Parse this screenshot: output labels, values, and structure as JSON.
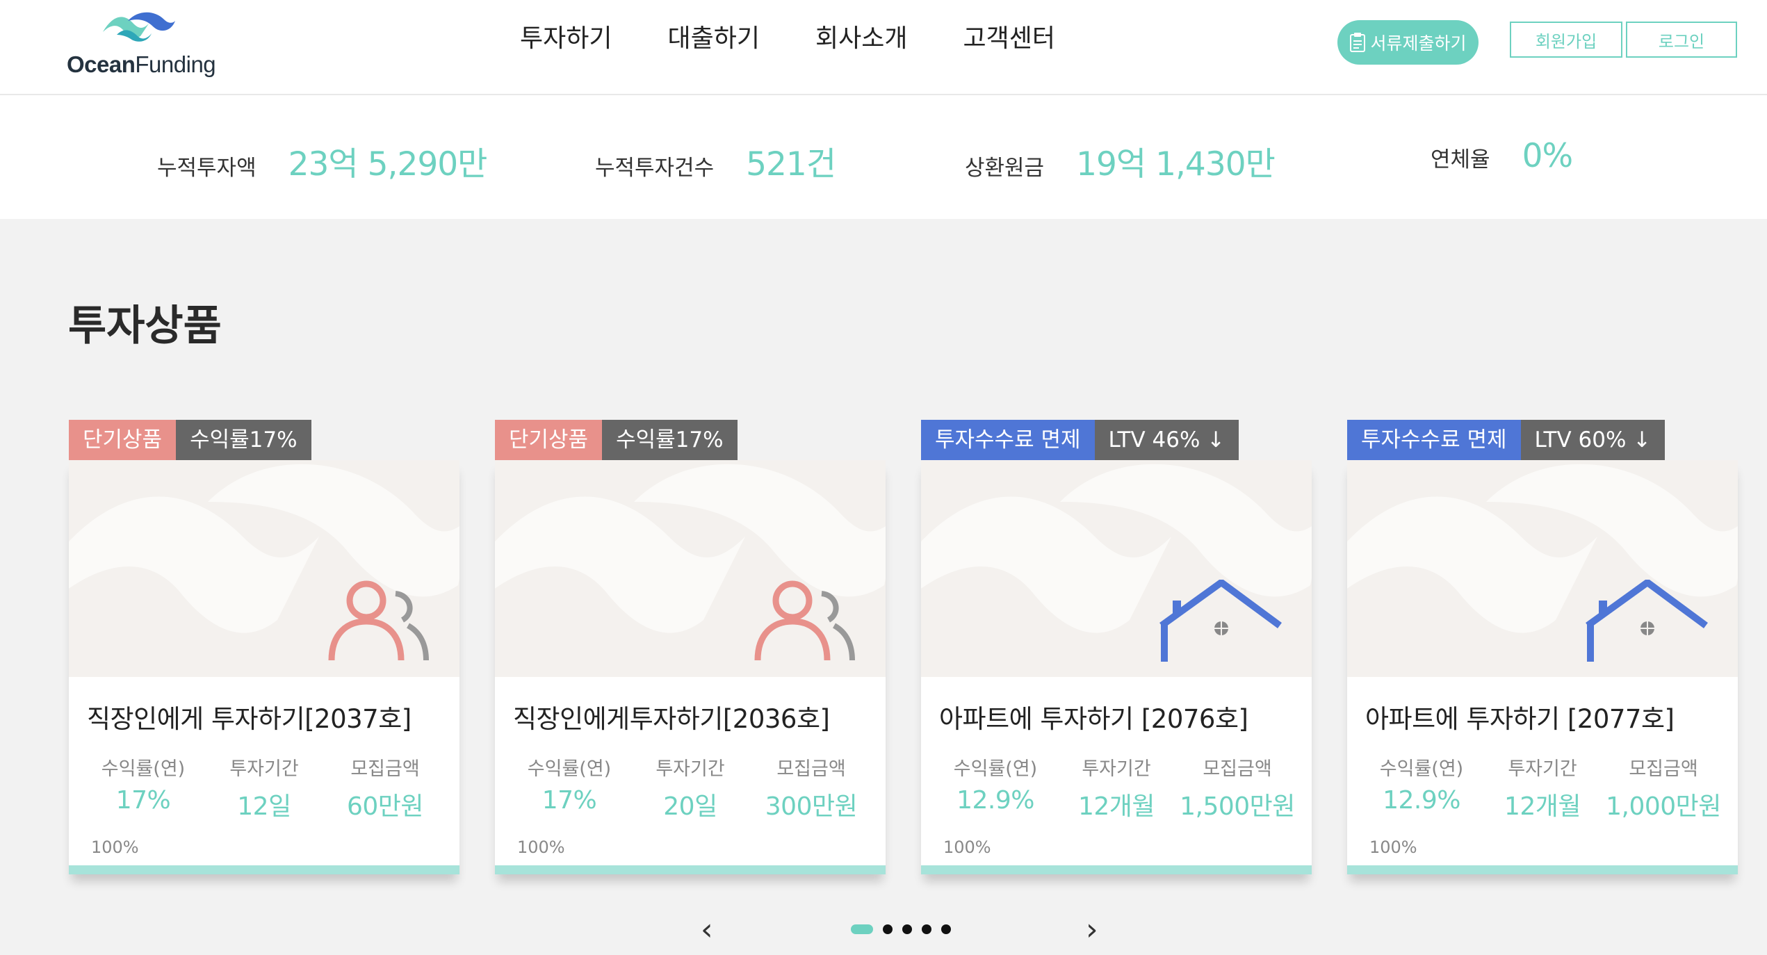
{
  "header": {
    "logo_bold": "Ocean",
    "logo_light": "Funding",
    "nav": [
      "투자하기",
      "대출하기",
      "회사소개",
      "고객센터"
    ],
    "submit_docs_label": "서류제출하기",
    "join_label": "회원가입",
    "login_label": "로그인"
  },
  "stats": [
    {
      "label": "누적투자액",
      "value": "23억 5,290만"
    },
    {
      "label": "누적투자건수",
      "value": "521건"
    },
    {
      "label": "상환원금",
      "value": "19억 1,430만"
    },
    {
      "label": "연체율",
      "value": "0%"
    }
  ],
  "section_title": "투자상품",
  "products": [
    {
      "tag1": "단기상품",
      "tag1_color": "#e8918b",
      "tag2": "수익률17%",
      "icon": "people-icon",
      "title": "직장인에게 투자하기[2037호]",
      "metric_labels": [
        "수익률(연)",
        "투자기간",
        "모집금액"
      ],
      "metric_values": [
        "17%",
        "12일",
        "60만원"
      ],
      "percent": "100%",
      "progress": 1.0
    },
    {
      "tag1": "단기상품",
      "tag1_color": "#e8918b",
      "tag2": "수익률17%",
      "icon": "people-icon",
      "title": "직장인에게투자하기[2036호]",
      "metric_labels": [
        "수익률(연)",
        "투자기간",
        "모집금액"
      ],
      "metric_values": [
        "17%",
        "20일",
        "300만원"
      ],
      "percent": "100%",
      "progress": 1.0
    },
    {
      "tag1": "투자수수료 면제",
      "tag1_color": "#4f76d6",
      "tag2": "LTV 46% ↓",
      "icon": "house-icon",
      "title": "아파트에 투자하기 [2076호]",
      "metric_labels": [
        "수익률(연)",
        "투자기간",
        "모집금액"
      ],
      "metric_values": [
        "12.9%",
        "12개월",
        "1,500만원"
      ],
      "percent": "100%",
      "progress": 1.0
    },
    {
      "tag1": "투자수수료 면제",
      "tag1_color": "#4f76d6",
      "tag2": "LTV 60% ↓",
      "icon": "house-icon",
      "title": "아파트에 투자하기 [2077호]",
      "metric_labels": [
        "수익률(연)",
        "투자기간",
        "모집금액"
      ],
      "metric_values": [
        "12.9%",
        "12개월",
        "1,000만원"
      ],
      "percent": "100%",
      "progress": 1.0
    }
  ],
  "pagination": {
    "prev": "‹",
    "next": "›",
    "active_index": 0,
    "count": 5
  },
  "colors": {
    "accent": "#6dd1c0",
    "pink": "#e8918b",
    "blue": "#4f76d6",
    "gray_tag": "#666666"
  }
}
